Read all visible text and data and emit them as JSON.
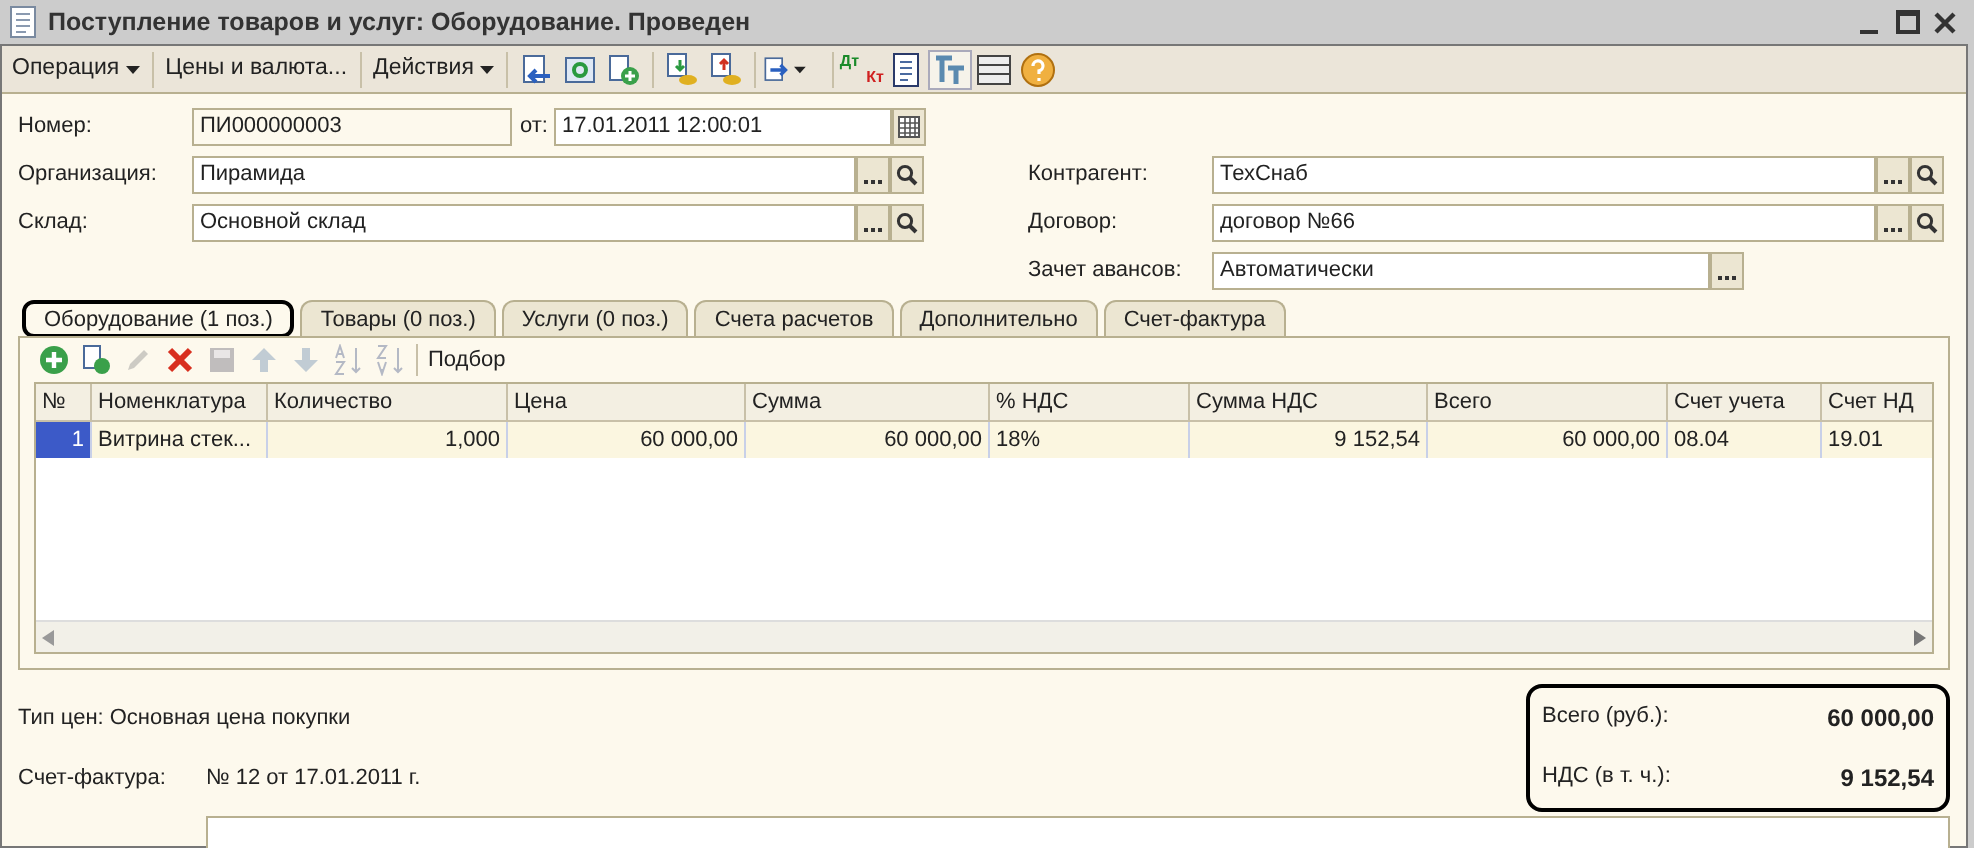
{
  "window": {
    "title": "Поступление товаров и услуг: Оборудование. Проведен"
  },
  "toolbar": [
    {
      "kind": "menu",
      "label": "Операция"
    },
    {
      "kind": "text",
      "label": "Цены и валюта..."
    },
    {
      "kind": "menu",
      "label": "Действия"
    },
    {
      "kind": "icon",
      "selected": false
    },
    {
      "kind": "icon",
      "selected": false
    },
    {
      "kind": "icon",
      "selected": false
    },
    {
      "kind": "icon",
      "selected": false
    },
    {
      "kind": "icon",
      "selected": false
    },
    {
      "kind": "icon",
      "selected": false
    },
    {
      "kind": "dtkt",
      "label": "Дт",
      "label2": "Кт"
    },
    {
      "kind": "icon",
      "selected": false
    },
    {
      "kind": "icon",
      "selected": true
    },
    {
      "kind": "icon",
      "selected": false
    },
    {
      "kind": "icon",
      "selected": false
    }
  ],
  "header_left": [
    {
      "label": "Номер:",
      "value": "ПИ000000003",
      "kind": "number",
      "date_label": "от:",
      "date": "17.01.2011 12:00:01"
    },
    {
      "label": "Организация:",
      "value": "Пирамида",
      "kind": "ref"
    },
    {
      "label": "Склад:",
      "value": "Основной склад",
      "kind": "ref"
    }
  ],
  "header_right": [
    {
      "label": "Контрагент:",
      "value": "ТехСнаб",
      "kind": "ref"
    },
    {
      "label": "Договор:",
      "value": "договор №66",
      "kind": "ref"
    },
    {
      "label": "Зачет авансов:",
      "value": "Автоматически",
      "kind": "choice"
    }
  ],
  "tabs": [
    {
      "label": "Оборудование (1 поз.)",
      "selected": true,
      "outlined": true
    },
    {
      "label": "Товары (0 поз.)",
      "selected": false,
      "outlined": false
    },
    {
      "label": "Услуги (0 поз.)",
      "selected": false,
      "outlined": false
    },
    {
      "label": "Счета расчетов",
      "selected": false,
      "outlined": false
    },
    {
      "label": "Дополнительно",
      "selected": false,
      "outlined": false
    },
    {
      "label": "Счет-фактура",
      "selected": false,
      "outlined": false
    }
  ],
  "table_toolbar": [
    {
      "kind": "icon",
      "disabled": false
    },
    {
      "kind": "icon",
      "disabled": false
    },
    {
      "kind": "icon",
      "disabled": true
    },
    {
      "kind": "icon",
      "disabled": false
    },
    {
      "kind": "icon",
      "disabled": true
    },
    {
      "kind": "icon",
      "disabled": true
    },
    {
      "kind": "icon",
      "disabled": true
    },
    {
      "kind": "icon",
      "disabled": true
    },
    {
      "kind": "icon",
      "disabled": true
    },
    {
      "kind": "text",
      "label": "Подбор"
    }
  ],
  "table": {
    "columns": [
      {
        "label": "№"
      },
      {
        "label": "Номенклатура"
      },
      {
        "label": "Количество"
      },
      {
        "label": "Цена"
      },
      {
        "label": "Сумма"
      },
      {
        "label": "% НДС"
      },
      {
        "label": "Сумма НДС"
      },
      {
        "label": "Всего"
      },
      {
        "label": "Счет учета"
      },
      {
        "label": "Счет НД"
      }
    ],
    "rows": [
      {
        "selected": true,
        "cells": [
          "1",
          "Витрина стек...",
          "1,000",
          "60 000,00",
          "60 000,00",
          "18%",
          "9 152,54",
          "60 000,00",
          "08.04",
          "19.01"
        ]
      }
    ]
  },
  "price_type": "Тип цен: Основная цена покупки",
  "invoice": {
    "label": "Счет-фактура:",
    "value": "№ 12 от 17.01.2011 г."
  },
  "totals": {
    "outlined": true,
    "items": [
      {
        "label": "Всего (руб.):",
        "value": "60 000,00"
      },
      {
        "label": "НДС (в т. ч.):",
        "value": "9 152,54"
      }
    ]
  }
}
